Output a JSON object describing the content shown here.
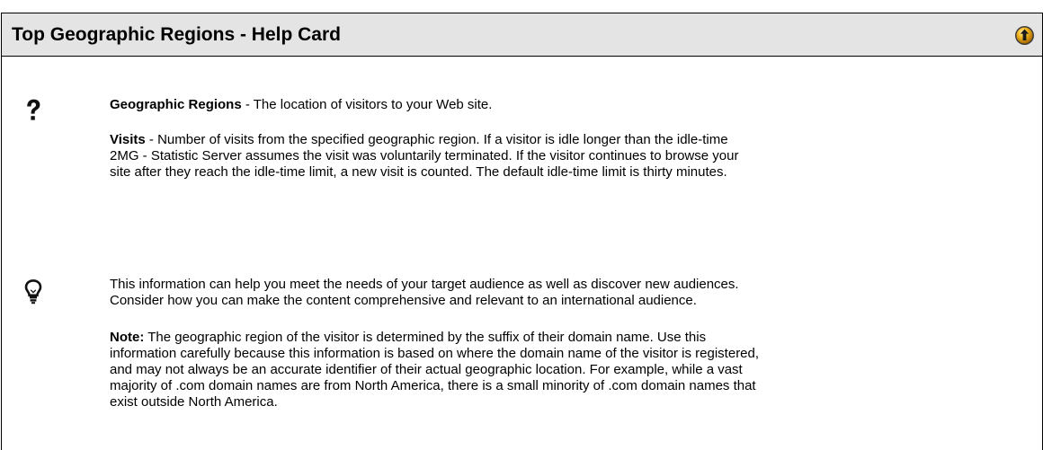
{
  "header": {
    "title": "Top Geographic Regions - Help Card",
    "top_button_icon": "up-arrow-circle-icon"
  },
  "definitions": {
    "icon": "question-mark-icon",
    "geographic_regions": {
      "term": "Geographic Regions",
      "text": " - The location of visitors to your Web site."
    },
    "visits": {
      "term": "Visits",
      "lines": [
        " - Number of visits from the specified geographic region. If a visitor is idle longer than the idle-time",
        "2MG - Statistic Server assumes the visit was voluntarily terminated. If the visitor continues to browse your",
        "site after they reach the idle-time limit, a new visit is counted. The default idle-time limit is thirty minutes."
      ]
    }
  },
  "tips": {
    "icon": "light-bulb-icon",
    "lines": [
      "This information can help you meet the needs of your target audience as well as discover new audiences.",
      "Consider how you can make the content comprehensive and relevant to an international audience."
    ],
    "note": {
      "label": "Note:",
      "lines": [
        " The geographic region of the visitor is determined by the suffix of their domain name. Use this",
        "information carefully because this information is based on where the domain name of the visitor is registered,",
        "and may not always be an accurate identifier of their actual geographic location. For example, while a vast",
        "majority of .com domain names are from North America, there is a small minority of .com domain names that",
        "exist outside North America."
      ]
    }
  },
  "colors": {
    "title_bar_bg": "#e4e4e4",
    "border": "#000000",
    "top_button_fill": "#f0a800"
  }
}
